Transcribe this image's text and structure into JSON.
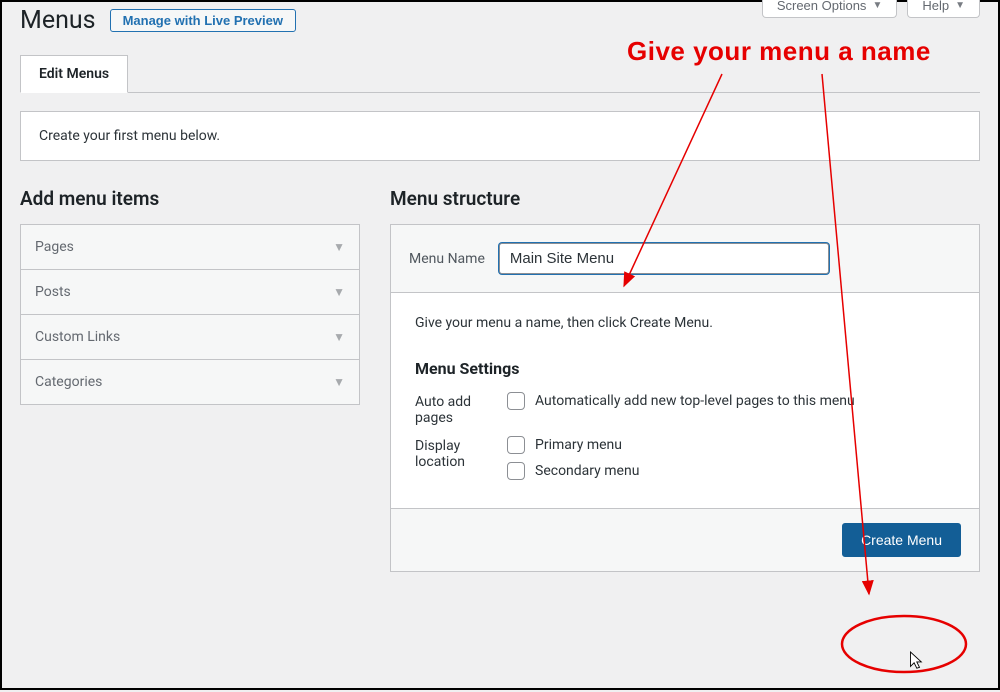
{
  "page_title": "Menus",
  "live_preview_btn": "Manage with Live Preview",
  "screen_options_btn": "Screen Options",
  "help_btn": "Help",
  "tab_edit": "Edit Menus",
  "notice_text": "Create your first menu below.",
  "left_heading": "Add menu items",
  "accordion": {
    "pages": "Pages",
    "posts": "Posts",
    "custom": "Custom Links",
    "categories": "Categories"
  },
  "right_heading": "Menu structure",
  "menu_name_label": "Menu Name",
  "menu_name_value": "Main Site Menu",
  "help_line": "Give your menu a name, then click Create Menu.",
  "settings_heading": "Menu Settings",
  "auto_add_label": "Auto add pages",
  "auto_add_option": "Automatically add new top-level pages to this menu",
  "display_loc_label": "Display location",
  "loc_primary": "Primary menu",
  "loc_secondary": "Secondary menu",
  "create_btn": "Create Menu",
  "annotation": "Give your menu a name"
}
